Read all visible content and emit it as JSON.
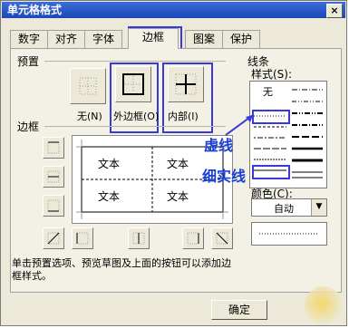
{
  "window": {
    "title": "单元格格式",
    "close": "×"
  },
  "tabs": [
    {
      "label": "数字"
    },
    {
      "label": "对齐"
    },
    {
      "label": "字体"
    },
    {
      "label": "边框"
    },
    {
      "label": "图案"
    },
    {
      "label": "保护"
    }
  ],
  "active_tab": "边框",
  "preset": {
    "section_label": "预置",
    "items": [
      {
        "label": "无(N)",
        "icon": "no-border-icon"
      },
      {
        "label": "外边框(O)",
        "icon": "outline-border-icon"
      },
      {
        "label": "内部(I)",
        "icon": "inside-border-icon"
      }
    ]
  },
  "border": {
    "section_label": "边框",
    "preview_cells": [
      "文本",
      "文本",
      "文本",
      "文本"
    ]
  },
  "line": {
    "section_label": "线条",
    "style_label": "样式(S):",
    "none_label": "无",
    "color_label": "颜色(C):",
    "color_value": "自动"
  },
  "annotations": {
    "dashed": "虚线",
    "thin_solid": "细实线"
  },
  "info_text": "单击预置选项、预览草图及上面的按钮可以添加边框样式。",
  "ok_label": "确定",
  "colors": {
    "highlight": "#3a3ad8",
    "annotation": "#1a3fd8",
    "title_bar": "#2a5ad0"
  }
}
